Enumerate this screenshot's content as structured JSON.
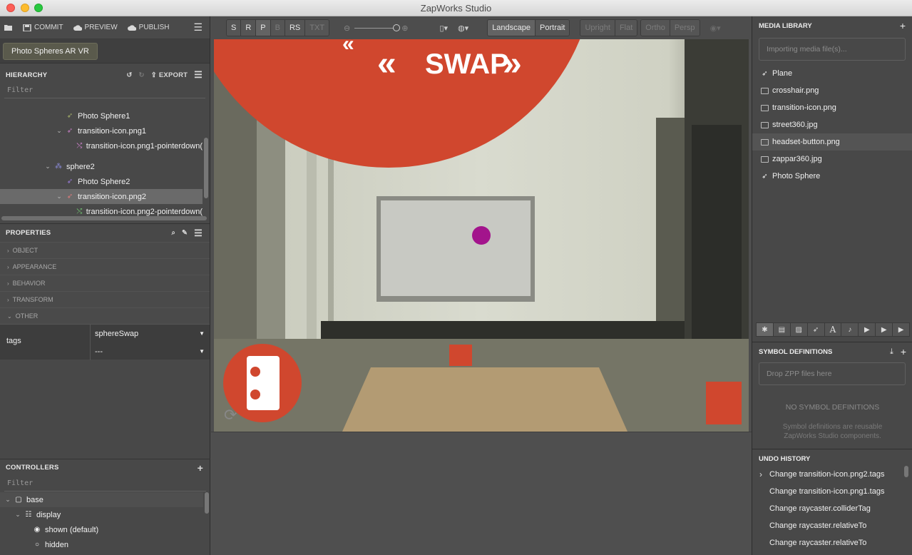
{
  "window": {
    "title": "ZapWorks Studio"
  },
  "toolbar": {
    "commit": "COMMIT",
    "preview": "PREVIEW",
    "publish": "PUBLISH",
    "menu": "☰"
  },
  "project": {
    "name": "Photo Spheres AR VR"
  },
  "hierarchy": {
    "title": "HIERARCHY",
    "export": "EXPORT",
    "filter": "Filter",
    "rows": [
      {
        "label": "Photo Sphere1"
      },
      {
        "label": "transition-icon.png1"
      },
      {
        "label": "transition-icon.png1-pointerdown("
      },
      {
        "label": "sphere2"
      },
      {
        "label": "Photo Sphere2"
      },
      {
        "label": "transition-icon.png2"
      },
      {
        "label": "transition-icon.png2-pointerdown("
      }
    ]
  },
  "properties": {
    "title": "PROPERTIES",
    "sections": [
      "OBJECT",
      "APPEARANCE",
      "BEHAVIOR",
      "TRANSFORM",
      "OTHER"
    ],
    "tags_label": "tags",
    "tag_value_1": "sphereSwap",
    "tag_value_2": "---"
  },
  "controllers": {
    "title": "CONTROLLERS",
    "filter": "Filter",
    "rows": [
      {
        "label": "base"
      },
      {
        "label": "display"
      },
      {
        "label": "shown (default)"
      },
      {
        "label": "hidden"
      }
    ]
  },
  "view_toolbar": {
    "group1": [
      "S",
      "R",
      "P",
      "B",
      "RS",
      "TXT"
    ],
    "landscape": "Landscape",
    "portrait": "Portrait",
    "upright": "Upright",
    "flat": "Flat",
    "ortho": "Ortho",
    "persp": "Persp"
  },
  "viewport": {
    "swap_text": "SWAP"
  },
  "media_library": {
    "title": "MEDIA LIBRARY",
    "placeholder": "Importing media file(s)...",
    "items": [
      {
        "label": "Plane",
        "icon": "rocket-icon"
      },
      {
        "label": "crosshair.png",
        "icon": "image-icon"
      },
      {
        "label": "transition-icon.png",
        "icon": "image-icon"
      },
      {
        "label": "street360.jpg",
        "icon": "image-icon"
      },
      {
        "label": "headset-button.png",
        "icon": "image-icon"
      },
      {
        "label": "zappar360.jpg",
        "icon": "image-icon"
      },
      {
        "label": "Photo Sphere",
        "icon": "rocket-icon"
      }
    ]
  },
  "symbols": {
    "title": "SYMBOL DEFINITIONS",
    "drop": "Drop ZPP files here",
    "empty": "NO SYMBOL DEFINITIONS",
    "desc": "Symbol definitions are reusable ZapWorks Studio components."
  },
  "undo": {
    "title": "UNDO HISTORY",
    "items": [
      "Change transition-icon.png2.tags",
      "Change transition-icon.png1.tags",
      "Change raycaster.colliderTag",
      "Change raycaster.relativeTo",
      "Change raycaster.relativeTo"
    ]
  },
  "colors": {
    "accent_red": "#d0472e",
    "cursor_magenta": "#a3148c",
    "selected_row": "#6a6a6a"
  }
}
